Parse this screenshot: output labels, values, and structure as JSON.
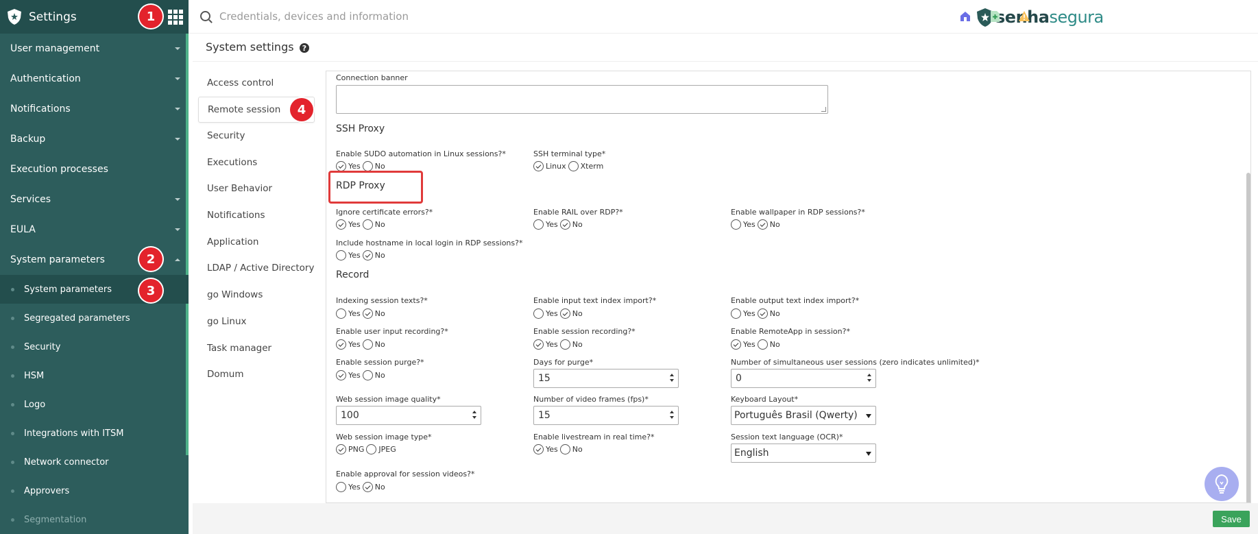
{
  "app": {
    "title": "Settings"
  },
  "sidebar": {
    "items": [
      {
        "label": "User management",
        "caret": "down"
      },
      {
        "label": "Authentication",
        "caret": "down"
      },
      {
        "label": "Notifications",
        "caret": "down"
      },
      {
        "label": "Backup",
        "caret": "down"
      },
      {
        "label": "Execution processes",
        "caret": "none"
      },
      {
        "label": "Services",
        "caret": "down"
      },
      {
        "label": "EULA",
        "caret": "down"
      },
      {
        "label": "System parameters",
        "caret": "up"
      }
    ],
    "subitems": [
      {
        "label": "System parameters",
        "active": true
      },
      {
        "label": "Segregated parameters"
      },
      {
        "label": "Security"
      },
      {
        "label": "HSM"
      },
      {
        "label": "Logo"
      },
      {
        "label": "Integrations with ITSM"
      },
      {
        "label": "Network connector"
      },
      {
        "label": "Approvers"
      },
      {
        "label": "Segmentation"
      }
    ]
  },
  "badges": [
    "1",
    "2",
    "3",
    "4"
  ],
  "search": {
    "placeholder": "Credentials, devices and information"
  },
  "brand": {
    "part1": "senha",
    "part2": "segura"
  },
  "topbar_icons": [
    "home-icon",
    "add-document-icon",
    "warning-icon"
  ],
  "page": {
    "title": "System settings",
    "help_glyph": "?"
  },
  "subnav": [
    "Access control",
    "Remote session",
    "Security",
    "Executions",
    "User Behavior",
    "Notifications",
    "Application",
    "LDAP / Active Directory",
    "go Windows",
    "go Linux",
    "Task manager",
    "Domum"
  ],
  "form": {
    "connection_banner": "Connection banner",
    "ssh_proxy": "SSH Proxy",
    "sudo_label": "Enable SUDO automation in Linux sessions?*",
    "ssh_terminal_label": "SSH terminal type*",
    "rdp_proxy": "RDP Proxy",
    "ignore_cert_label": "Ignore certificate errors?*",
    "rail_label": "Enable RAIL over RDP?*",
    "wallpaper_label": "Enable wallpaper in RDP sessions?*",
    "hostname_label": "Include hostname in local login in RDP sessions?*",
    "record": "Record",
    "idx_texts_label": "Indexing session texts?*",
    "input_idx_label": "Enable input text index import?*",
    "output_idx_label": "Enable output text index import?*",
    "user_input_rec_label": "Enable user input recording?*",
    "session_rec_label": "Enable session recording?*",
    "remoteapp_label": "Enable RemoteApp in session?*",
    "purge_label": "Enable session purge?*",
    "days_purge_label": "Days for purge*",
    "days_purge_value": "15",
    "simul_label": "Number of simultaneous user sessions (zero indicates unlimited)*",
    "simul_value": "0",
    "img_quality_label": "Web session image quality*",
    "img_quality_value": "100",
    "fps_label": "Number of video frames (fps)*",
    "fps_value": "15",
    "keyboard_label": "Keyboard Layout*",
    "keyboard_value": "Português Brasil (Qwerty)",
    "img_type_label": "Web session image type*",
    "livestream_label": "Enable livestream in real time?*",
    "ocr_label": "Session text language (OCR)*",
    "ocr_value": "English",
    "approval_label": "Enable approval for session videos?*",
    "yes": "Yes",
    "no": "No",
    "linux": "Linux",
    "xterm": "Xterm",
    "png": "PNG",
    "jpeg": "JPEG"
  },
  "footer": {
    "save": "Save"
  },
  "colors": {
    "sidebar": "#2d5d5c",
    "accent": "#4fb28a",
    "badge": "#e3232c",
    "save": "#3aa35b"
  }
}
